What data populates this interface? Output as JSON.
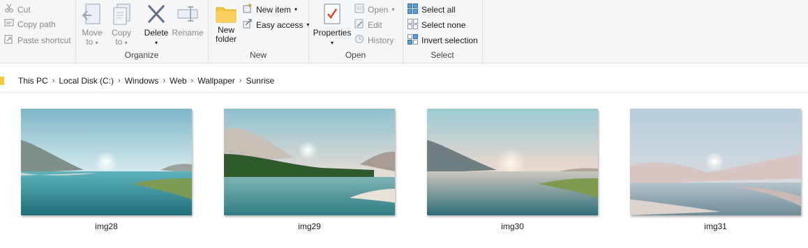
{
  "ribbon": {
    "clipboard": {
      "cut": "Cut",
      "copy_path": "Copy path",
      "paste_shortcut": "Paste shortcut"
    },
    "organize": {
      "label": "Organize",
      "move_to": [
        "Move",
        "to"
      ],
      "copy_to": [
        "Copy",
        "to"
      ],
      "delete": "Delete",
      "rename": "Rename"
    },
    "new": {
      "label": "New",
      "new_folder": [
        "New",
        "folder"
      ],
      "new_item": "New item",
      "easy_access": "Easy access"
    },
    "open": {
      "label": "Open",
      "properties": "Properties",
      "open": "Open",
      "edit": "Edit",
      "history": "History"
    },
    "select": {
      "label": "Select",
      "select_all": "Select all",
      "select_none": "Select none",
      "invert_selection": "Invert selection"
    }
  },
  "breadcrumb": [
    "This PC",
    "Local Disk (C:)",
    "Windows",
    "Web",
    "Wallpaper",
    "Sunrise"
  ],
  "files": [
    {
      "name": "img28"
    },
    {
      "name": "img29"
    },
    {
      "name": "img30"
    },
    {
      "name": "img31"
    }
  ],
  "colors": {
    "accent": "#1e6fd9",
    "disabled": "#8a8a8a",
    "ribbon_bg": "#f5f6f7",
    "folder": "#f4c542"
  }
}
